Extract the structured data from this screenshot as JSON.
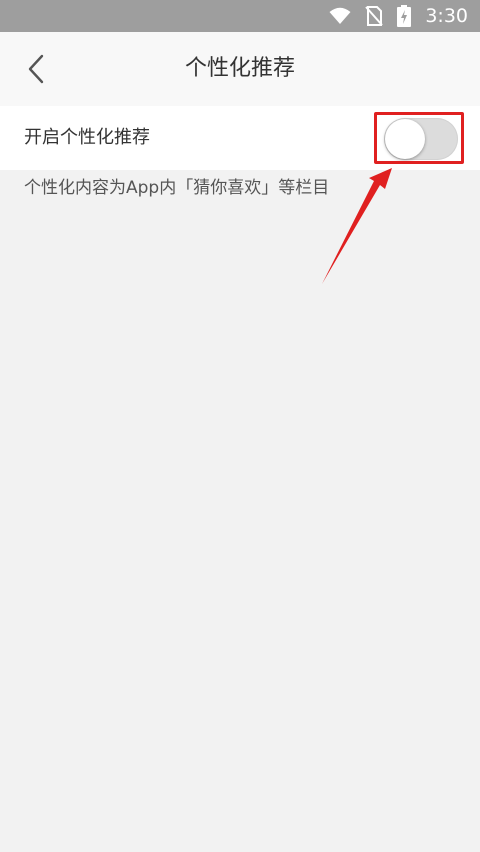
{
  "status_bar": {
    "time": "3:30",
    "icons": [
      "wifi-icon",
      "no-sim-icon",
      "battery-charging-icon"
    ]
  },
  "header": {
    "title": "个性化推荐",
    "back_icon": "chevron-left-icon"
  },
  "setting": {
    "label": "开启个性化推荐",
    "enabled": false,
    "description": "个性化内容为App内「猜你喜欢」等栏目"
  },
  "annotation": {
    "color": "#e02020",
    "target": "toggle"
  }
}
